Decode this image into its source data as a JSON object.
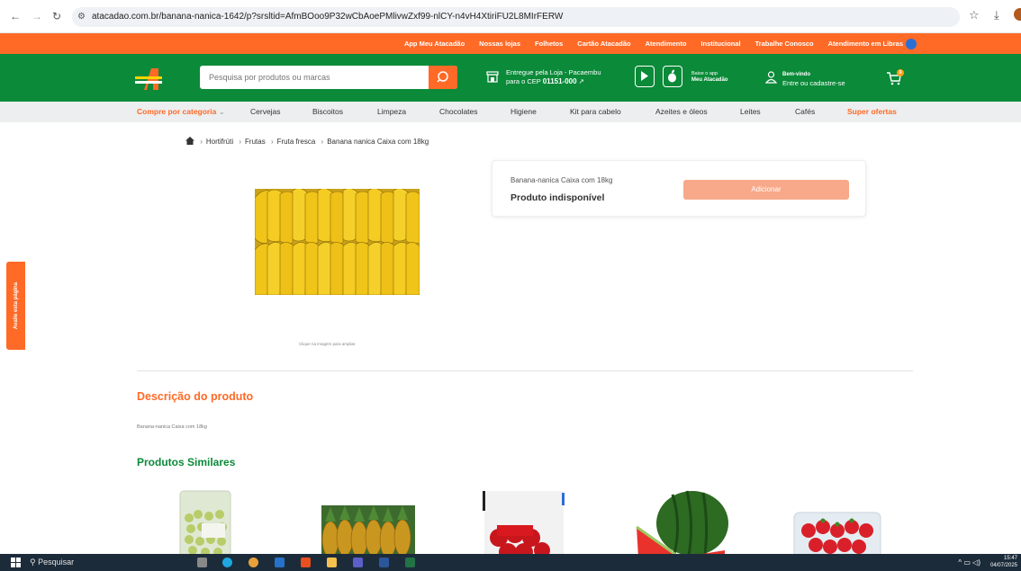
{
  "browser": {
    "url": "atacadao.com.br/banana-nanica-1642/p?srsltid=AfmBOoo9P32wCbAoePMlivwZxf99-nlCY-n4vH4XtiriFU2L8MIrFERW"
  },
  "topbar": {
    "links": [
      "App Meu Atacadão",
      "Nossas lojas",
      "Folhetos",
      "Cartão Atacadão",
      "Atendimento",
      "Institucional",
      "Trabalhe Conosco",
      "Atendimento em Libras"
    ]
  },
  "header": {
    "search_placeholder": "Pesquisa por produtos ou marcas",
    "store_line1": "Entregue pela Loja - Pacaembu",
    "store_line2_prefix": "para o CEP",
    "store_cep": "01151-000",
    "app_line1": "Baixe o app",
    "app_line2": "Meu Atacadão",
    "user_line1": "Bem-vindo",
    "user_line2": "Entre ou cadastre-se",
    "cart_count": "0"
  },
  "categories": {
    "browse_label": "Compre por categoria",
    "items": [
      "Cervejas",
      "Biscoitos",
      "Limpeza",
      "Chocolates",
      "Higiene",
      "Kit para cabelo",
      "Azeites e óleos",
      "Leites",
      "Cafés"
    ],
    "offers_label": "Super ofertas"
  },
  "breadcrumb": [
    "Hortifrúti",
    "Frutas",
    "Fruta fresca",
    "Banana nanica Caixa com 18kg"
  ],
  "product": {
    "name": "Banana-nanica Caixa com 18kg",
    "status": "Produto indisponível",
    "add_label": "Adicionar",
    "zoom_hint": "Clique na imagem para ampliar",
    "description_title": "Descrição do produto",
    "description_text": "Banana-nanica Caixa com 18kg"
  },
  "similar": {
    "title": "Produtos Similares"
  },
  "feedback_label": "Avalie esta página",
  "taskbar": {
    "search_label": "Pesquisar",
    "time": "15:47",
    "date": "04/07/2025"
  },
  "colors": {
    "orange": "#ff6a27",
    "green": "#0b8a39",
    "button_disabled": "#f7a98a"
  }
}
